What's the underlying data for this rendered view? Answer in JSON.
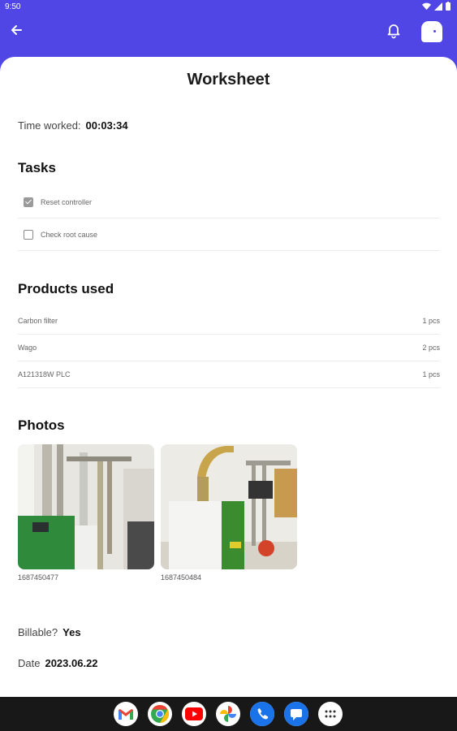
{
  "status": {
    "time": "9:50"
  },
  "header": {
    "title": "Worksheet"
  },
  "time_worked": {
    "label": "Time worked:",
    "value": "00:03:34"
  },
  "tasks": {
    "heading": "Tasks",
    "items": [
      {
        "label": "Reset controller",
        "checked": true
      },
      {
        "label": "Check root cause",
        "checked": false
      }
    ]
  },
  "products": {
    "heading": "Products used",
    "items": [
      {
        "name": "Carbon filter",
        "qty": "1 pcs"
      },
      {
        "name": "Wago",
        "qty": "2 pcs"
      },
      {
        "name": "A121318W PLC",
        "qty": "1 pcs"
      }
    ]
  },
  "photos": {
    "heading": "Photos",
    "items": [
      {
        "caption": "1687450477"
      },
      {
        "caption": "1687450484"
      }
    ]
  },
  "billable": {
    "label": "Billable?",
    "value": "Yes"
  },
  "date": {
    "label": "Date",
    "value": "2023.06.22"
  },
  "dock": [
    "gmail-icon",
    "chrome-icon",
    "youtube-icon",
    "photos-icon",
    "phone-icon",
    "messages-icon",
    "app-drawer-icon"
  ],
  "colors": {
    "primary": "#4f46e5",
    "navbar": "#181818"
  }
}
